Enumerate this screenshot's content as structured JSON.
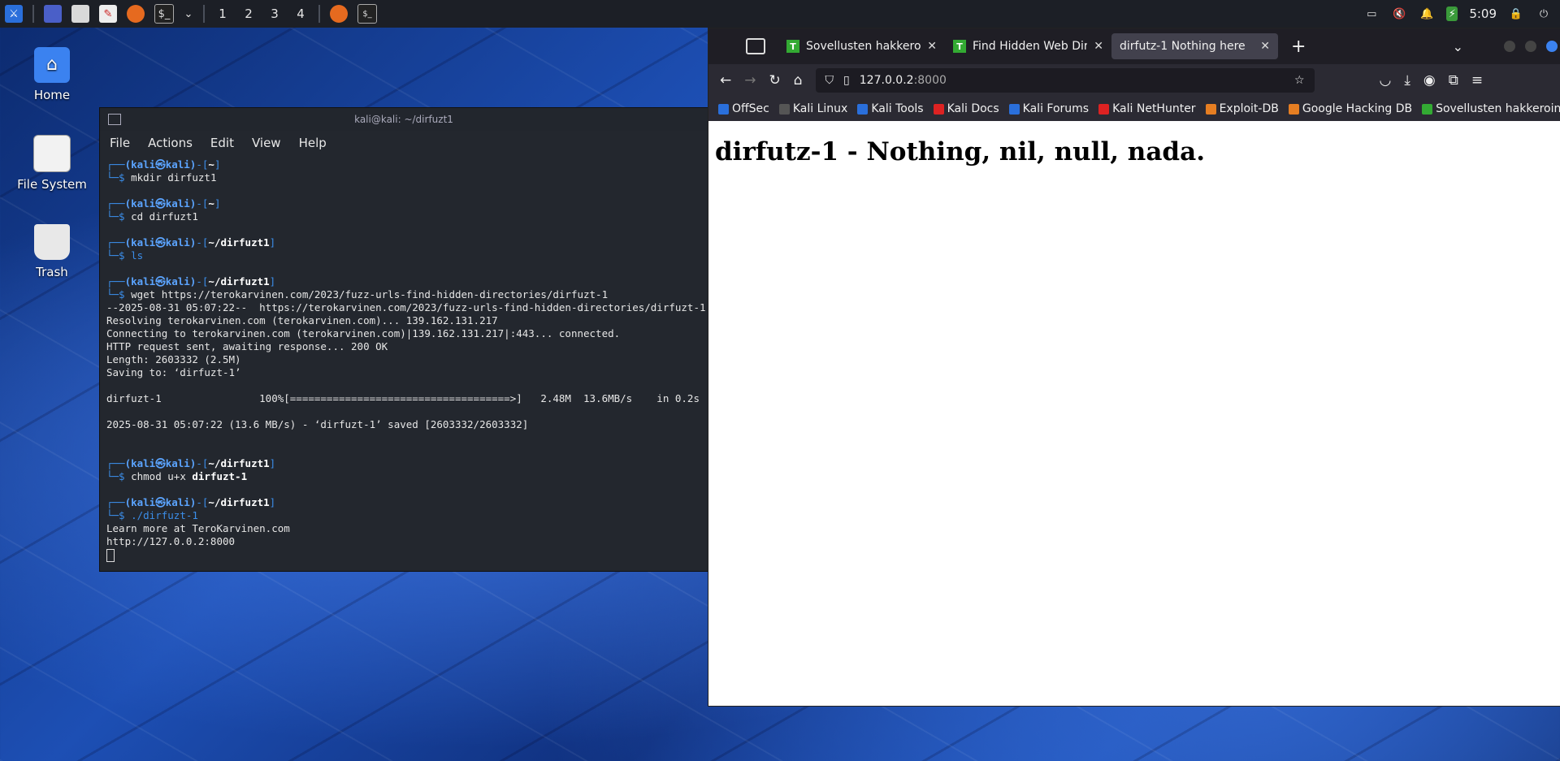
{
  "taskbar": {
    "workspaces": [
      "1",
      "2",
      "3",
      "4"
    ],
    "clock": "5:09"
  },
  "desktop": {
    "icons": [
      {
        "label": "Home"
      },
      {
        "label": "File System"
      },
      {
        "label": "Trash"
      }
    ]
  },
  "terminal": {
    "title": "kali@kali: ~/dirfuzt1",
    "menu": [
      "File",
      "Actions",
      "Edit",
      "View",
      "Help"
    ],
    "prompt_user": "(kali㉿kali)",
    "lines": {
      "p1_dir": "~",
      "c1": "mkdir dirfuzt1",
      "p2_dir": "~",
      "c2": "cd dirfuzt1",
      "p3_dir": "~/dirfuzt1",
      "c3": "ls",
      "p4_dir": "~/dirfuzt1",
      "c4": "wget https://terokarvinen.com/2023/fuzz-urls-find-hidden-directories/dirfuzt-1",
      "o1": "--2025-08-31 05:07:22--  https://terokarvinen.com/2023/fuzz-urls-find-hidden-directories/dirfuzt-1",
      "o2": "Resolving terokarvinen.com (terokarvinen.com)... 139.162.131.217",
      "o3": "Connecting to terokarvinen.com (terokarvinen.com)|139.162.131.217|:443... connected.",
      "o4": "HTTP request sent, awaiting response... 200 OK",
      "o5": "Length: 2603332 (2.5M)",
      "o6": "Saving to: ‘dirfuzt-1’",
      "o7": "dirfuzt-1                100%[====================================>]   2.48M  13.6MB/s    in 0.2s",
      "o8": "2025-08-31 05:07:22 (13.6 MB/s) - ‘dirfuzt-1’ saved [2603332/2603332]",
      "p5_dir": "~/dirfuzt1",
      "c5a": "chmod u+x ",
      "c5b": "dirfuzt-1",
      "p6_dir": "~/dirfuzt1",
      "c6": "./dirfuzt-1",
      "o9": "Learn more at TeroKarvinen.com",
      "o10": "http://127.0.0.2:8000"
    }
  },
  "browser": {
    "tabs": [
      {
        "fav": "T",
        "title": "Sovellusten hakkerointi -"
      },
      {
        "fav": "T",
        "title": "Find Hidden Web Directo"
      },
      {
        "fav": "",
        "title": "dirfutz-1 Nothing here"
      }
    ],
    "url_host": "127.0.0.2",
    "url_port": ":8000",
    "bookmarks": [
      "OffSec",
      "Kali Linux",
      "Kali Tools",
      "Kali Docs",
      "Kali Forums",
      "Kali NetHunter",
      "Exploit-DB",
      "Google Hacking DB",
      "Sovellusten hakkeroin..."
    ],
    "page_heading": "dirfutz-1 - Nothing, nil, null, nada."
  }
}
